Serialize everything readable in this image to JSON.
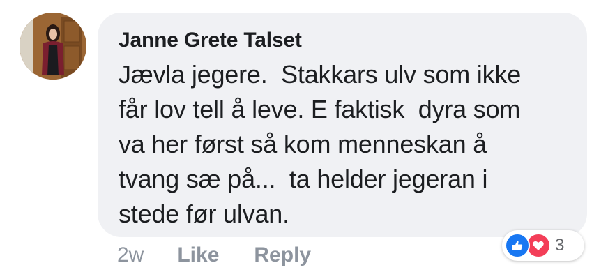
{
  "comment": {
    "author": "Janne Grete Talset",
    "text": "Jævla jegere.  Stakkars ulv som ikke\nfår lov tell å leve. E faktisk  dyra som\nva her først så kom menneskan å\ntvang sæ på...  ta helder jegeran i\nstede før ulvan.",
    "avatar_icon": "profile-photo"
  },
  "actions": {
    "time": "2w",
    "like_label": "Like",
    "reply_label": "Reply"
  },
  "reactions": {
    "count": "3",
    "icons": [
      "like-icon",
      "love-icon"
    ],
    "like_color": "#1877f2",
    "love_color": "#f33e58"
  },
  "colors": {
    "bubble_bg": "#f0f1f4",
    "text": "#1c1e21",
    "muted": "#8d949e"
  }
}
